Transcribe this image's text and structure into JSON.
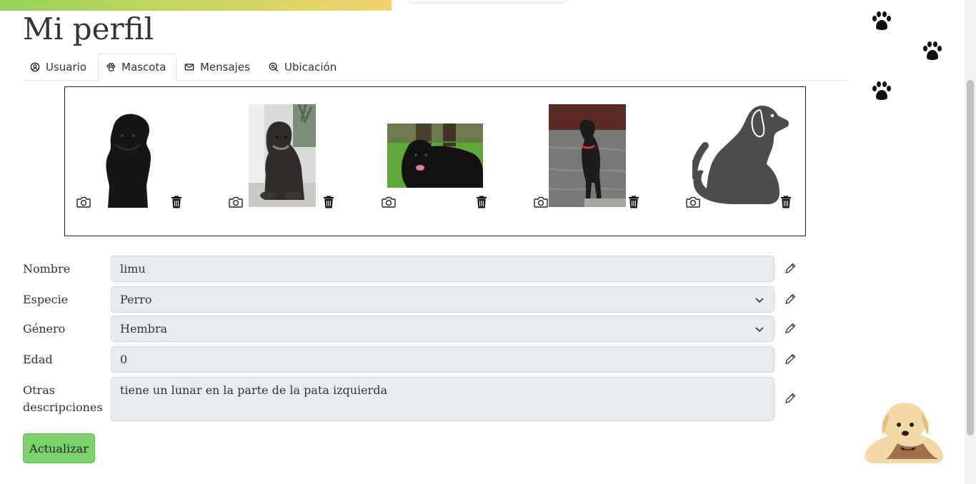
{
  "page": {
    "title": "Mi perfil"
  },
  "tabs": [
    {
      "label": "Usuario",
      "icon": "user-circle-icon"
    },
    {
      "label": "Mascota",
      "icon": "paw-icon",
      "active": true
    },
    {
      "label": "Mensajes",
      "icon": "envelope-icon"
    },
    {
      "label": "Ubicación",
      "icon": "location-icon"
    }
  ],
  "gallery": {
    "photos": [
      {
        "name": "photo-1",
        "kind": "black terrier sitting"
      },
      {
        "name": "photo-2",
        "kind": "schnauzer lying"
      },
      {
        "name": "photo-3",
        "kind": "dog lying on grass"
      },
      {
        "name": "photo-4",
        "kind": "schnauzer standing"
      },
      {
        "name": "photo-5",
        "kind": "placeholder dog silhouette"
      }
    ],
    "camera_icon": "camera-icon",
    "delete_icon": "trash-icon"
  },
  "form": {
    "nombre": {
      "label": "Nombre",
      "value": "limu"
    },
    "especie": {
      "label": "Especie",
      "value": "Perro"
    },
    "genero": {
      "label": "Género",
      "value": "Hembra"
    },
    "edad": {
      "label": "Edad",
      "value": "0"
    },
    "otras": {
      "label_line1": "Otras",
      "label_line2": "descripciones",
      "value": "tiene un lunar en la parte de la pata izquierda"
    },
    "submit_label": "Actualizar"
  },
  "colors": {
    "accent_green": "#7bd46b",
    "field_bg": "#e9ecef",
    "gradient_start": "#96d35b",
    "gradient_end": "#f3d26b"
  }
}
